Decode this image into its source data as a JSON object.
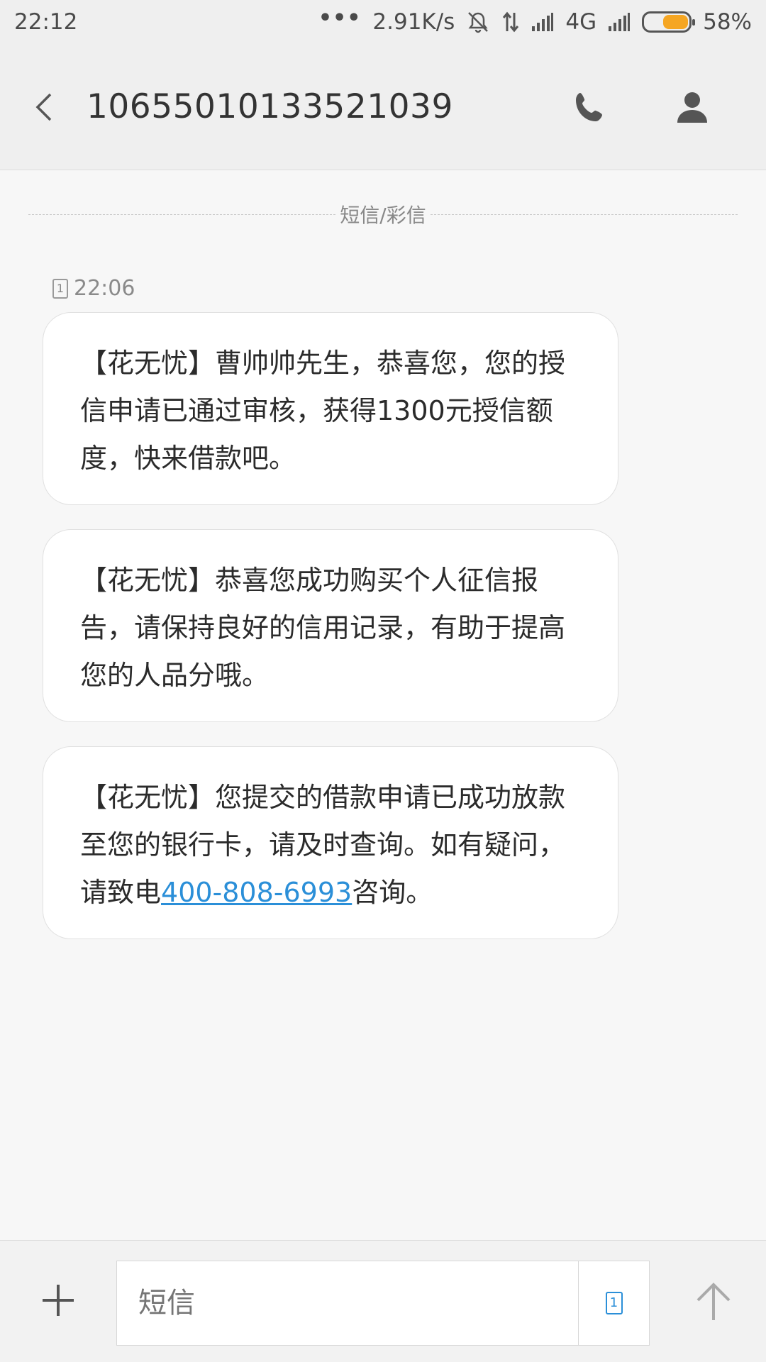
{
  "status_bar": {
    "time": "22:12",
    "dots": "•••",
    "net_speed": "2.91K/s",
    "network_type": "4G",
    "battery_percent": "58%",
    "battery_level": 0.58,
    "battery_color": "#f5a623",
    "icons": [
      "silent-alarm-icon",
      "data-transfer-icon",
      "signal-icon",
      "signal-icon-2",
      "battery-icon"
    ]
  },
  "header": {
    "title": "10655010133521039",
    "back_icon": "chevron-left-icon",
    "call_icon": "phone-icon",
    "contact_icon": "person-icon"
  },
  "divider": {
    "label": "短信/彩信"
  },
  "thread": {
    "timestamp": "22:06",
    "sim_label": "1",
    "messages": [
      {
        "text": "【花无忧】曹帅帅先生，恭喜您，您的授信申请已通过审核，获得1300元授信额度，快来借款吧。"
      },
      {
        "text": "【花无忧】恭喜您成功购买个人征信报告，请保持良好的信用记录，有助于提高您的人品分哦。"
      },
      {
        "text_before": "【花无忧】您提交的借款申请已成功放款至您的银行卡，请及时查询。如有疑问，请致电",
        "phone": "400-808-6993",
        "text_after": "咨询。"
      }
    ]
  },
  "composer": {
    "placeholder": "短信",
    "sim_label": "1",
    "accent_color": "#2b8fd8",
    "add_icon": "plus-icon",
    "send_icon": "arrow-up-icon"
  }
}
